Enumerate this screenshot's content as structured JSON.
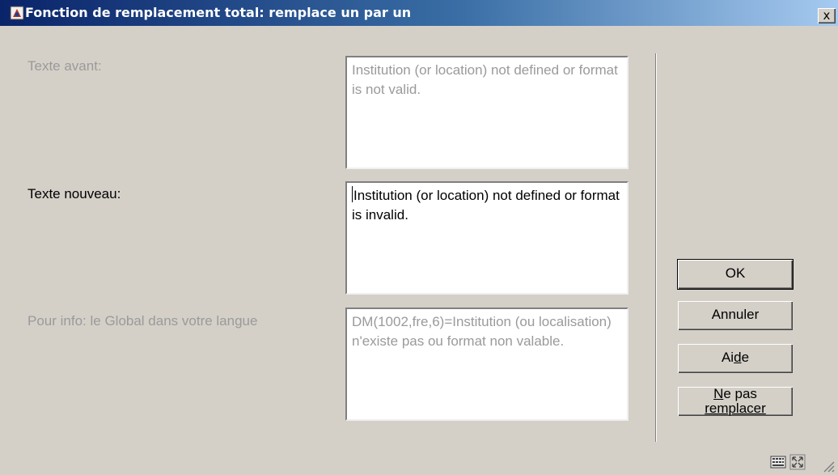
{
  "window": {
    "title": "Fonction de remplacement total: remplace un par un",
    "close_label": "x",
    "app_icon": "vubis-app-icon"
  },
  "fields": {
    "texte_avant": {
      "label": "Texte avant:",
      "value": "Institution (or location) not defined or format is not valid.",
      "enabled": false
    },
    "texte_nouveau": {
      "label": "Texte nouveau:",
      "value": "Institution (or location) not defined or format is invalid.",
      "enabled": true
    },
    "pour_info": {
      "label": "Pour info: le Global dans votre langue",
      "value": "DM(1002,fre,6)=Institution (ou localisation) n'existe pas ou format non valable.",
      "enabled": false
    }
  },
  "buttons": {
    "ok": "OK",
    "annuler": "Annuler",
    "aide_pre": "Ai",
    "aide_u": "d",
    "aide_post": "e",
    "ne_pas_u": "N",
    "ne_pas_rest": "e pas",
    "remplacer": "remplacer"
  },
  "status_bar": {
    "icons": [
      "keyboard-icon",
      "expand-icon",
      "resize-grip-icon"
    ]
  },
  "colors": {
    "dialog_bg": "#d4d0c8",
    "titlebar_start": "#0a246a",
    "titlebar_end": "#a6caf0",
    "disabled_text": "#9a9a9a"
  }
}
